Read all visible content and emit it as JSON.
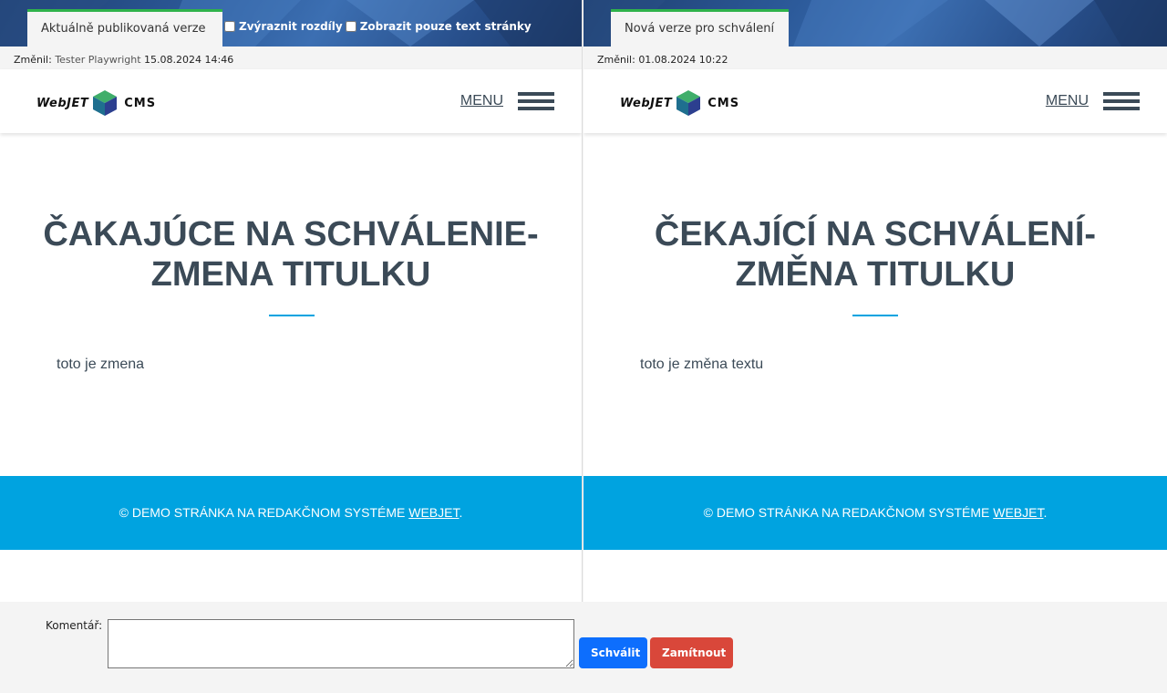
{
  "colors": {
    "accent_tab": "#2fb24b",
    "footer_bg": "#00a3e0",
    "heading": "#3b4a57",
    "approve": "#0d6efd",
    "reject": "#d9473a"
  },
  "left": {
    "tab_label": "Aktuálně publikovaná verze",
    "highlight_label": "Zvýraznit rozdíly",
    "text_only_label": "Zobrazit pouze text stránky",
    "changed_prefix": "Změnil:",
    "changed_user": "Tester Playwright",
    "changed_date": "15.08.2024 14:46",
    "logo_left": "WebJET",
    "logo_right": "CMS",
    "menu_label": "MENU",
    "title": "ČAKAJÚCE NA SCHVÁLENIE-ZMENA TITULKU",
    "body": "toto je zmena",
    "footer_text": "© DEMO STRÁNKA NA REDAKČNOM SYSTÉME ",
    "footer_link": "WEBJET",
    "footer_end": "."
  },
  "right": {
    "tab_label": "Nová verze pro schválení",
    "changed_prefix": "Změnil:",
    "changed_user": "",
    "changed_date": "01.08.2024 10:22",
    "logo_left": "WebJET",
    "logo_right": "CMS",
    "menu_label": "MENU",
    "title": "ČEKAJÍCÍ NA SCHVÁLENÍ-ZMĚNA TITULKU",
    "body": "toto je změna textu",
    "footer_text": "© DEMO STRÁNKA NA REDAKČNOM SYSTÉME ",
    "footer_link": "WEBJET",
    "footer_end": "."
  },
  "bottom": {
    "comment_label": "Komentář:",
    "comment_value": "",
    "approve_label": "Schválit",
    "reject_label": "Zamítnout"
  }
}
